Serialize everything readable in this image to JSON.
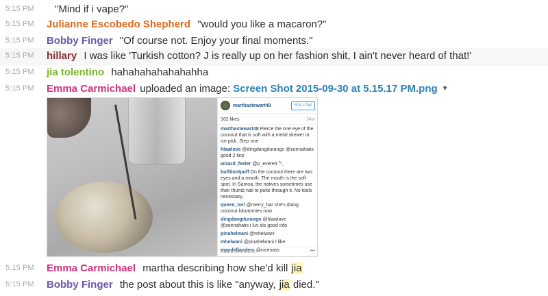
{
  "messages": [
    {
      "time": "5:15 PM",
      "author": "",
      "text": "\"Mind if i vape?\""
    },
    {
      "time": "5:15 PM",
      "author": "Julianne Escobedo Shepherd",
      "color": "#e06a1e",
      "text": "\"would you like a macaron?\""
    },
    {
      "time": "5:15 PM",
      "author": "Bobby Finger",
      "color": "#6b55a8",
      "text": "\"Of course not. Enjoy your final moments.\""
    },
    {
      "time": "5:15 PM",
      "author": "hillary",
      "color": "#8a2c2c",
      "text": "I was like 'Turkish cotton? J is really up on her fashion shit, I ain't never heard of that!'"
    },
    {
      "time": "5:15 PM",
      "author": "jia tolentino",
      "color": "#79b62a",
      "text": "hahahahahahahahha"
    }
  ],
  "upload": {
    "time": "5:15 PM",
    "author": "Emma Carmichael",
    "color": "#d6307a",
    "action": "uploaded an image:",
    "filename": "Screen Shot 2015-09-30 at 5.15.17 PM.png",
    "caret": "▼"
  },
  "instagram": {
    "username": "marthastewart48",
    "follow": "FOLLOW",
    "likes": "162 likes",
    "age": "34w",
    "comments": [
      {
        "user": "marthastewart48",
        "text": "Pierce the one eye of the coconut that is soft with a metal skewer or ice pick. Step one"
      },
      {
        "user": "hlawlove",
        "text": "@dingdangdurango @zoenahatis good 2 kno"
      },
      {
        "user": "wizard_feeler",
        "text": "@p_everett 🔪"
      },
      {
        "user": "buffdontpuff",
        "text": "On the coconut there are two eyes and a mouth. The mouth is the soft spot. In Samoa, the natives sometimes use their thumb nail to poke through it. No tools necessary."
      },
      {
        "user": "queen_tori",
        "text": "@merry_bar she's doing coconut lobotomies now"
      },
      {
        "user": "dingdangdurango",
        "text": "@hlawlove @zoenahatis i luv dis good info"
      },
      {
        "user": "pinahelwani",
        "text": "@mhelwani"
      },
      {
        "user": "mhelwani",
        "text": "@pinahelwani I like"
      },
      {
        "user": "maudeflanders",
        "text": "@nicesass"
      }
    ],
    "add_comment": "Add a comment...",
    "more": "•••"
  },
  "after": [
    {
      "time": "5:15 PM",
      "author": "Emma Carmichael",
      "color": "#d6307a",
      "text_before": "martha describing how she'd kill ",
      "mention": "jia",
      "text_after": ""
    },
    {
      "time": "5:15 PM",
      "author": "Bobby Finger",
      "color": "#6b55a8",
      "text_before": "the post about this is like \"anyway, ",
      "mention": "jia",
      "text_after": " died.\""
    }
  ]
}
